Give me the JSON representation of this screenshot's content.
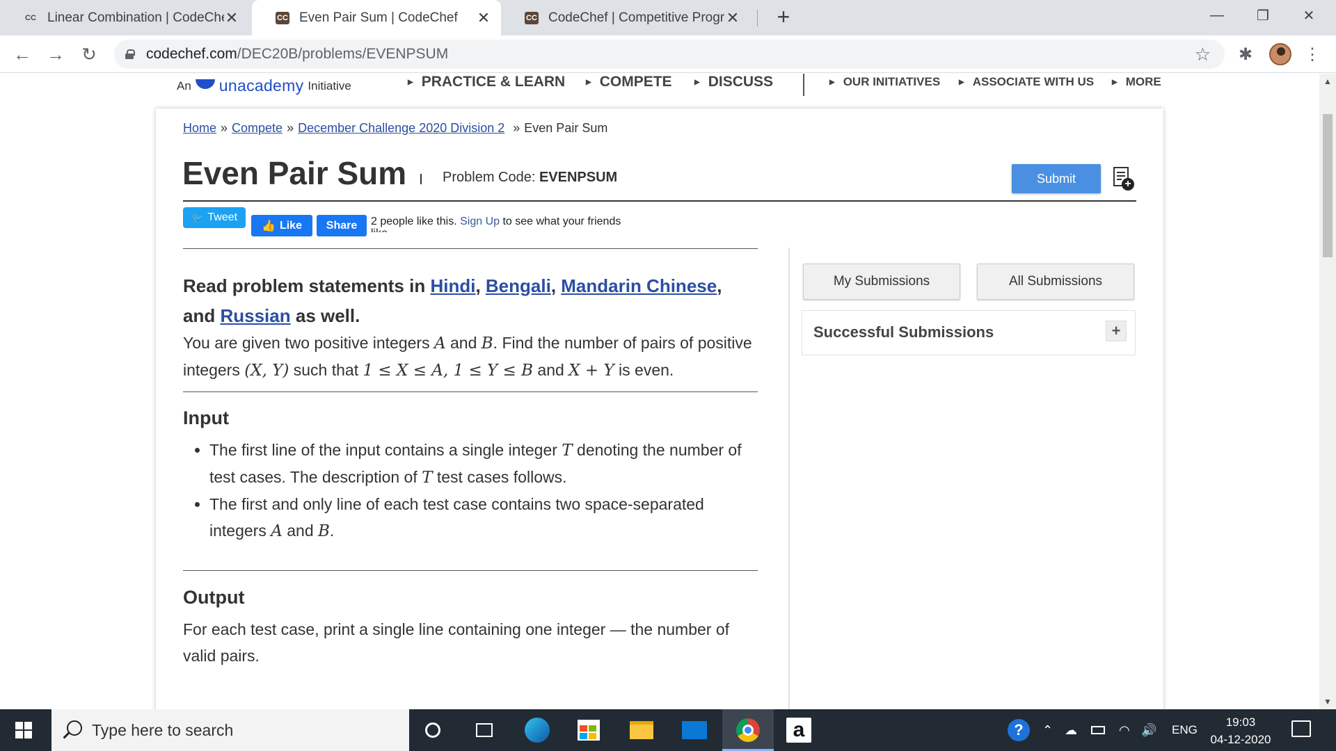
{
  "browser": {
    "tabs": [
      {
        "title": "Linear Combination | CodeChef",
        "favicon": "codechef-favicon",
        "active": false
      },
      {
        "title": "Even Pair Sum | CodeChef",
        "favicon": "codechef-favicon",
        "active": true
      },
      {
        "title": "CodeChef | Competitive Programm",
        "favicon": "codechef-favicon",
        "active": false
      }
    ],
    "close_glyph": "✕",
    "new_tab_glyph": "+",
    "favicon_text": "CC",
    "url_host": "codechef.com",
    "url_path": "/DEC20B/problems/EVENPSUM",
    "window_controls": {
      "minimize": "—",
      "restore": "❐",
      "close": "✕"
    }
  },
  "site": {
    "brand_prefix": "An",
    "brand_name": "unacademy",
    "brand_suffix": "Initiative",
    "nav_main": [
      "PRACTICE & LEARN",
      "COMPETE",
      "DISCUSS"
    ],
    "nav_secondary": [
      "OUR INITIATIVES",
      "ASSOCIATE WITH US",
      "MORE"
    ]
  },
  "problem": {
    "breadcrumb": [
      "Home",
      "Compete",
      "December Challenge 2020 Division 2",
      "Even Pair Sum"
    ],
    "breadcrumb_sep": "»",
    "title": "Even Pair Sum",
    "code_label": "Problem Code:",
    "code": "EVENPSUM",
    "submit_label": "Submit"
  },
  "social": {
    "tweet": "Tweet",
    "like": "Like",
    "share": "Share",
    "like_text_a": "2 people like this.",
    "sign_up": "Sign Up",
    "like_text_b": "to see what your friends",
    "like_text_c": "like."
  },
  "statement": {
    "read_prefix": "Read problem statements in",
    "languages": [
      "Hindi",
      "Bengali",
      "Mandarin Chinese",
      "Russian"
    ],
    "read_and": "and",
    "read_suffix": "as well.",
    "intro_1": "You are given two positive integers",
    "intro_A": "A",
    "intro_and": "and",
    "intro_B": "B",
    "intro_2": ". Find the number of pairs of positive integers",
    "intro_pair": "(X, Y)",
    "intro_3": "such that",
    "intro_cond": "1 ≤ X ≤ A, 1 ≤ Y ≤ B",
    "intro_4": "and",
    "intro_sum": "X + Y",
    "intro_5": "is even.",
    "input_title": "Input",
    "input_1a": "The first line of the input contains a single integer",
    "input_T": "T",
    "input_1b": "denoting the number of test cases. The description of",
    "input_1c": "test cases follows.",
    "input_2a": "The first and only line of each test case contains two space-separated integers",
    "input_2A": "A",
    "input_2and": "and",
    "input_2B": "B",
    "input_2end": ".",
    "output_title": "Output",
    "output_text": "For each test case, print a single line containing one integer — the number of valid pairs."
  },
  "sidebar": {
    "my_submissions": "My Submissions",
    "all_submissions": "All Submissions",
    "successful_title": "Successful Submissions",
    "expand": "+"
  },
  "taskbar": {
    "search_placeholder": "Type here to search",
    "tray_lang": "ENG",
    "time": "19:03",
    "date": "04-12-2020"
  },
  "colors": {
    "link": "#2b4ea2",
    "submit": "#4a90e2",
    "twitter": "#1da1f2",
    "facebook": "#1877f2",
    "taskbar": "#222a33"
  }
}
